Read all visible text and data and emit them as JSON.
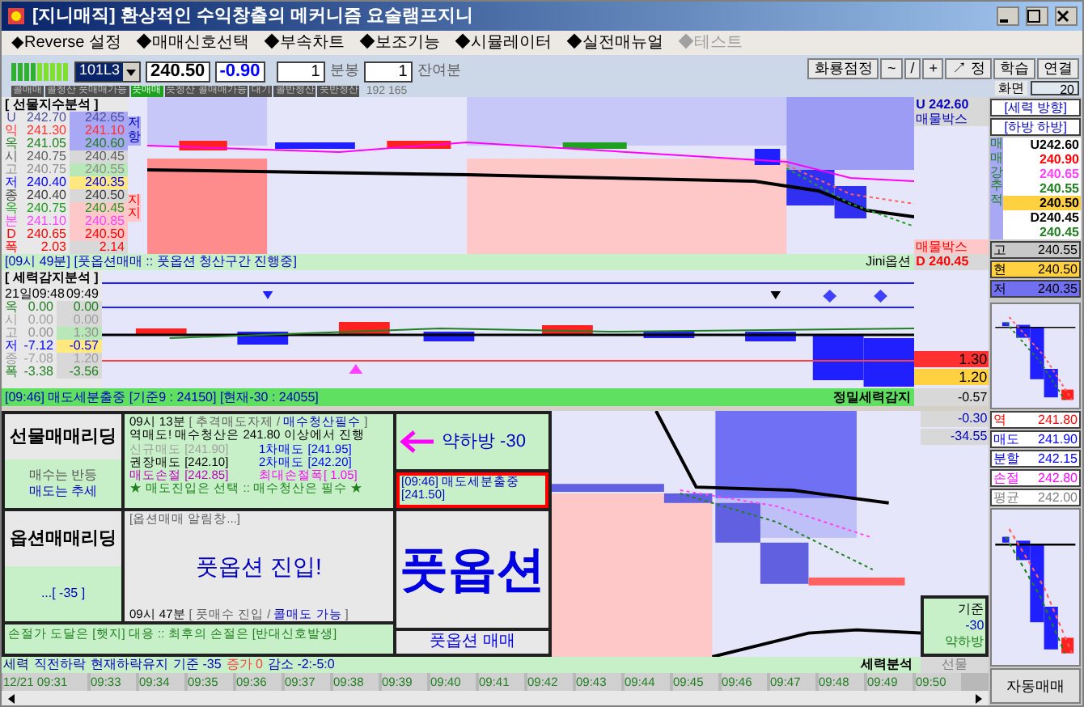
{
  "window": {
    "title": "[지니매직] 환상적인 수익창출의 메커니즘 요술램프지니"
  },
  "menu": [
    {
      "label": "◆Reverse 설정",
      "disabled": false
    },
    {
      "label": "◆매매신호선택",
      "disabled": false
    },
    {
      "label": "◆부속차트",
      "disabled": false
    },
    {
      "label": "◆보조기능",
      "disabled": false
    },
    {
      "label": "◆시뮬레이터",
      "disabled": false
    },
    {
      "label": "◆실전매뉴얼",
      "disabled": false
    },
    {
      "label": "◆테스트",
      "disabled": true
    }
  ],
  "toolbar": {
    "symbol": "101L3",
    "price": "240.50",
    "change": "-0.90",
    "interval": "1",
    "interval_unit": "분봉",
    "remaining": "1",
    "remaining_unit": "잔여분",
    "signals": [
      {
        "label": "콜매매",
        "selected": false
      },
      {
        "label": "콜청산 풋매매가능",
        "selected": false
      },
      {
        "label": "풋매매",
        "selected": true
      },
      {
        "label": "풋청산 콜매매가능",
        "selected": false
      },
      {
        "label": "대기",
        "selected": false
      },
      {
        "label": "콜반청산",
        "selected": false
      },
      {
        "label": "풋반청산",
        "selected": false
      }
    ],
    "counts": "192 165",
    "tools": [
      "화룡점정",
      "~",
      "/",
      "+",
      "↗ 정",
      "학습",
      "연결"
    ],
    "screen_label": "화면",
    "screen_value": "20"
  },
  "futures_panel": {
    "title": "[ 선물지수분석 ]",
    "rows": [
      {
        "label": "U",
        "values": [
          "242.70",
          "242.65"
        ],
        "color": "#5050a0",
        "kind": "resistance"
      },
      {
        "label": "익",
        "values": [
          "241.30",
          "241.10"
        ],
        "color": "#ff3030",
        "kind": "resistance"
      },
      {
        "label": "옥",
        "values": [
          "241.05",
          "240.60"
        ],
        "color": "#208020",
        "kind": "resistance"
      },
      {
        "label": "시",
        "values": [
          "240.75",
          "240.45"
        ],
        "color": "#606060",
        "kind": "plain"
      },
      {
        "label": "고",
        "values": [
          "240.75",
          "240.55"
        ],
        "color": "#909090",
        "kind": "high"
      },
      {
        "label": "저",
        "values": [
          "240.40",
          "240.35"
        ],
        "color": "#0000ff",
        "kind": "low"
      },
      {
        "label": "종",
        "values": [
          "240.40",
          "240.50"
        ],
        "color": "#404040",
        "kind": "plain"
      },
      {
        "label": "옥",
        "values": [
          "240.75",
          "240.45"
        ],
        "color": "#20a020",
        "kind": "support"
      },
      {
        "label": "본",
        "values": [
          "241.10",
          "240.85"
        ],
        "color": "#ff40ff",
        "kind": "support"
      },
      {
        "label": "D",
        "values": [
          "240.65",
          "240.50"
        ],
        "color": "#ff0000",
        "kind": "support"
      },
      {
        "label": "폭",
        "values": [
          "2.03",
          "2.14"
        ],
        "color": "#ff0000",
        "kind": "plain"
      }
    ],
    "resistance": "저항",
    "support": "지지",
    "upper_price": "U 242.60",
    "box_top": "매물박스",
    "box_bottom": "매물박스",
    "lower_price": "D 240.45",
    "status": "[09시 49분] [풋옵션매매 :: 풋옵션 청산구간 진행중]",
    "source": "Jini옵션"
  },
  "force_panel": {
    "title": "[ 세력감지분석 ]",
    "date": "21일09:48",
    "time": "09:49",
    "rows": [
      {
        "label": "옥",
        "values": [
          "0.00",
          "0.00"
        ],
        "color": "#208020",
        "kind": "plain"
      },
      {
        "label": "시",
        "values": [
          "0.00",
          "0.00"
        ],
        "color": "#a0a0a0",
        "kind": "plain"
      },
      {
        "label": "고",
        "values": [
          "0.00",
          "1.30"
        ],
        "color": "#909090",
        "kind": "high"
      },
      {
        "label": "저",
        "values": [
          "-7.12",
          "-0.57"
        ],
        "color": "#0000ff",
        "kind": "low"
      },
      {
        "label": "종",
        "values": [
          "-7.08",
          "1.20"
        ],
        "color": "#a0a0a0",
        "kind": "plain"
      },
      {
        "label": "폭",
        "values": [
          "-3.38",
          "-3.56"
        ],
        "color": "#208020",
        "kind": "plain"
      }
    ],
    "high": "1.30",
    "low": "1.20",
    "status": "[09:46] 매도세분출중 [기준9 : 24150] [현재-30 : 24055]",
    "detector": "정밀세력감지",
    "reading": "-0.57"
  },
  "leading": {
    "futures_title": "선물매매리딩",
    "futures_notes": [
      "매수는 반등",
      "매도는 추세"
    ],
    "options_title": "옵션매매리딩",
    "options_note": "...[ -35 ]",
    "info_header": [
      {
        "text": "09시 13분",
        "color": "#000000"
      },
      {
        "text": "[ 추격매도자제 /",
        "color": "#606060"
      },
      {
        "text": "매수청산필수",
        "color": "#0000c0"
      },
      {
        "text": "]"
      }
    ],
    "info_headline": "역매도! 매수청산은 241.80 이상에서 진행",
    "info_levels": [
      {
        "text": "신규매도 [241.90]",
        "color": "#a0a0a0"
      },
      {
        "text": "1차매도 [241.95]",
        "color": "#0000ff"
      },
      {
        "text": "권장매도 [242.10]",
        "color": "#000000"
      },
      {
        "text": "2차매도 [242.20]",
        "color": "#0000ff"
      },
      {
        "text": "매도손절 [242.85]",
        "color": "#c000c0"
      },
      {
        "text": "최대손절폭[ 1.05]",
        "color": "#ff00ff"
      }
    ],
    "info_footer": "★ 매도진입은 선택 :: 매수청산은 필수 ★",
    "alert_title": "[옵션매매 알림창...]",
    "alert_message": "풋옵션 진입!",
    "alert_footer": [
      {
        "text": "09시 47분",
        "color": "#000000"
      },
      {
        "text": "[ 풋매수 진입 /",
        "color": "#606060"
      },
      {
        "text": "콜매도 가능",
        "color": "#0000c0"
      },
      {
        "text": "]"
      }
    ],
    "direction": "약하방 -30",
    "signal": "[09:46] 매도세분출중[241.50]",
    "big_signal": "풋옵션",
    "big_signal_sub": "풋옵션 매매",
    "stop_note": "손절가 도달은 [햇지] 대응 :: 최후의 손절은 [반대신호발생]",
    "readings": [
      "-0.30",
      "-34.55"
    ],
    "basis": [
      "기준",
      "-30",
      "약하방"
    ],
    "analysis": "세력분석",
    "futures": "선물"
  },
  "trend_bar": [
    {
      "text": "세력",
      "color": "#000080"
    },
    {
      "text": "직전하락",
      "color": "#0000c0"
    },
    {
      "text": "현재하락유지",
      "color": "#0000c0"
    },
    {
      "text": "기준 -35",
      "color": "#0000c0"
    },
    {
      "text": "증가 0",
      "color": "#ff4040"
    },
    {
      "text": "감소 -2:-5:0",
      "color": "#0000c0"
    }
  ],
  "time_axis": [
    "12/21 09:31",
    "09:33",
    "09:34",
    "09:35",
    "09:36",
    "09:37",
    "09:38",
    "09:39",
    "09:40",
    "09:41",
    "09:42",
    "09:43",
    "09:44",
    "09:45",
    "09:46",
    "09:47",
    "09:48",
    "09:49",
    "09:50"
  ],
  "side": {
    "direction_title": "[세력 방향]",
    "direction": "[하방 하방]",
    "tracker_label": "매매강추적",
    "tracker": [
      {
        "text": "U242.60",
        "color": "#000000",
        "kind": "plain"
      },
      {
        "text": "240.90",
        "color": "#ff0000",
        "kind": "plain"
      },
      {
        "text": "240.65",
        "color": "#ff40ff",
        "kind": "plain"
      },
      {
        "text": "240.55",
        "color": "#208020",
        "kind": "plain"
      },
      {
        "text": "240.50",
        "kind": "current"
      },
      {
        "text": "D240.45",
        "color": "#000000",
        "kind": "plain"
      },
      {
        "text": "240.45",
        "color": "#208020",
        "kind": "plain"
      }
    ],
    "levels": [
      {
        "label": "고",
        "value": "240.55",
        "kind": "high"
      },
      {
        "label": "현",
        "value": "240.50",
        "kind": "current"
      },
      {
        "label": "저",
        "value": "240.35",
        "kind": "low"
      }
    ],
    "orders": [
      {
        "label": "역",
        "value": "241.80",
        "color": "#ff0000"
      },
      {
        "label": "매도",
        "value": "241.90",
        "color": "#0000ff"
      },
      {
        "label": "분할",
        "value": "242.15",
        "color": "#0000ff"
      },
      {
        "label": "손절",
        "value": "242.80",
        "color": "#ff00ff"
      },
      {
        "label": "평균",
        "value": "242.00",
        "color": "#808080"
      }
    ],
    "auto_button": "자동매매"
  }
}
